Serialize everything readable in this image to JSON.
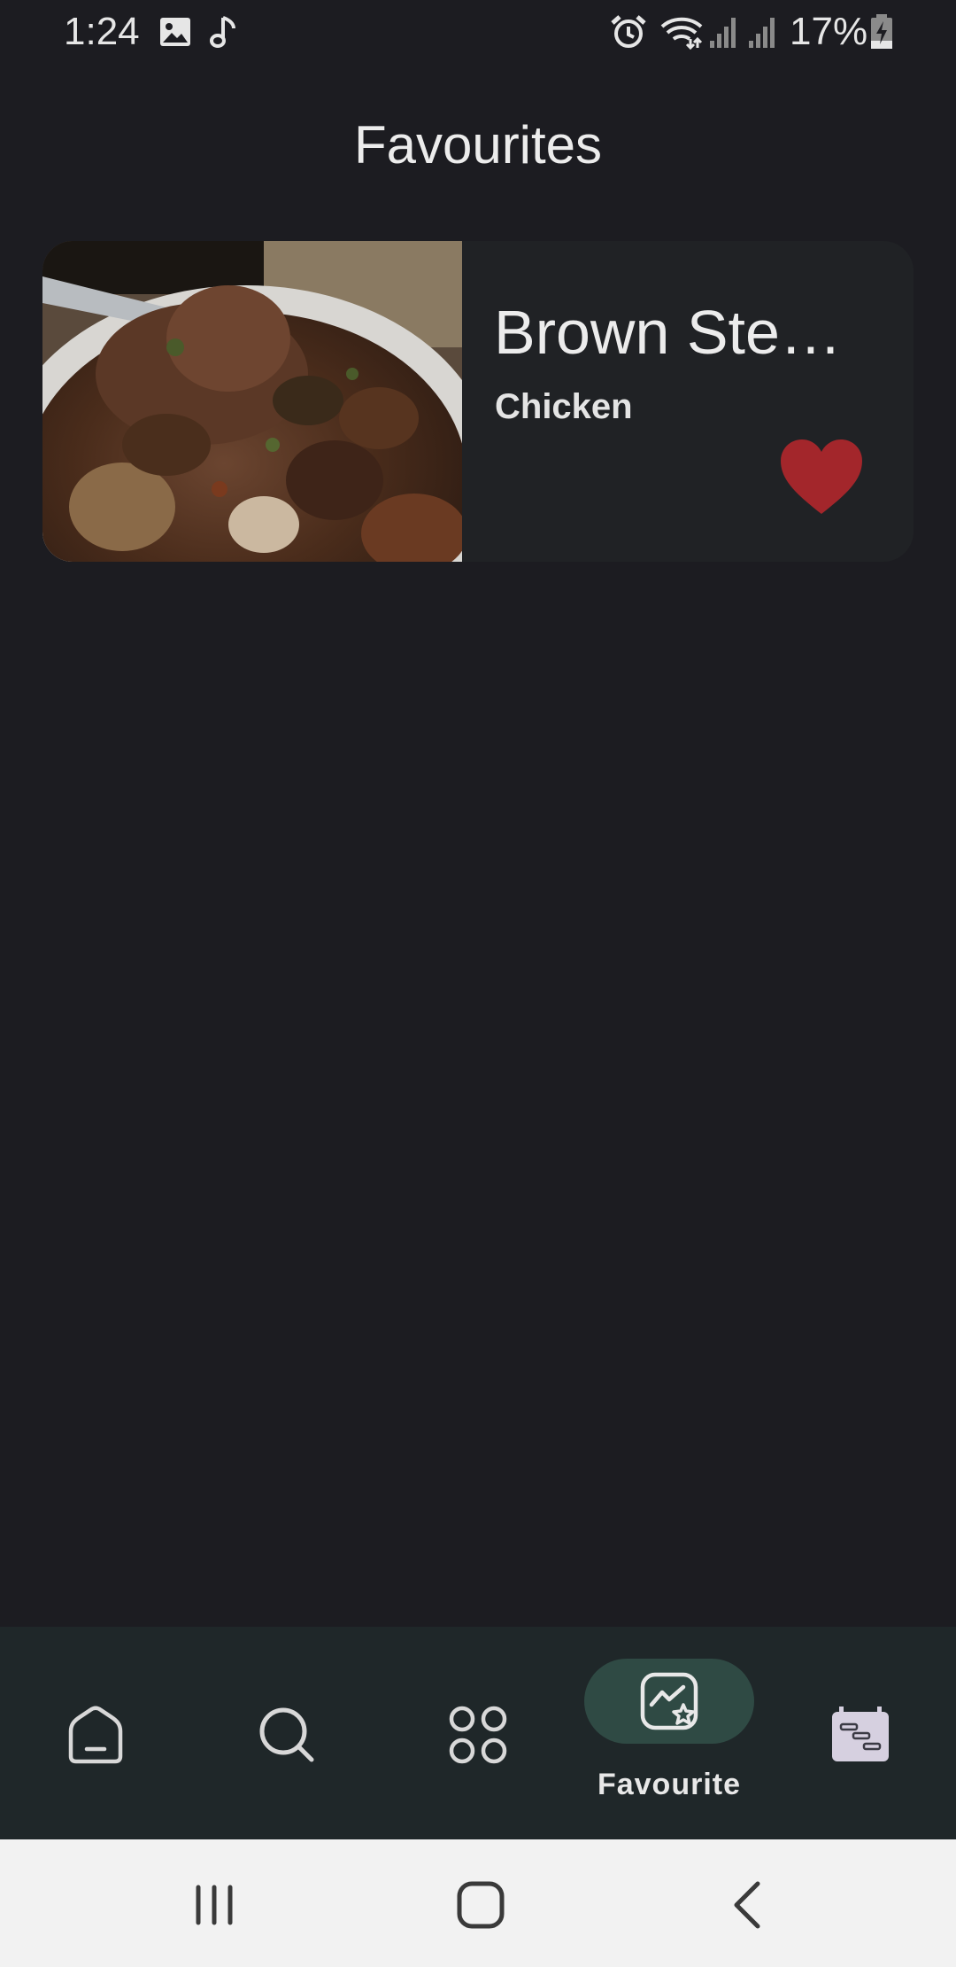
{
  "status_bar": {
    "time": "1:24",
    "battery_percent": "17%",
    "icons": [
      "image-icon",
      "music-note-icon",
      "alarm-icon",
      "wifi-icon",
      "signal-icon",
      "signal-icon",
      "battery-charging-icon"
    ]
  },
  "header": {
    "title": "Favourites"
  },
  "favourites": [
    {
      "name": "Brown Ste…",
      "category": "Chicken",
      "is_favourite": true
    }
  ],
  "bottom_nav": {
    "items": [
      {
        "icon": "home-icon",
        "label": ""
      },
      {
        "icon": "search-icon",
        "label": ""
      },
      {
        "icon": "categories-grid-icon",
        "label": ""
      },
      {
        "icon": "favourite-icon",
        "label": "Favourite",
        "active": true
      },
      {
        "icon": "planner-icon",
        "label": ""
      }
    ]
  },
  "system_nav": {
    "buttons": [
      "recents-icon",
      "home-button-icon",
      "back-icon"
    ]
  },
  "colors": {
    "background": "#1c1c21",
    "card": "#202225",
    "heart": "#a3262b",
    "nav_bar": "#1f2729",
    "nav_active_pill": "#2f4a44"
  }
}
